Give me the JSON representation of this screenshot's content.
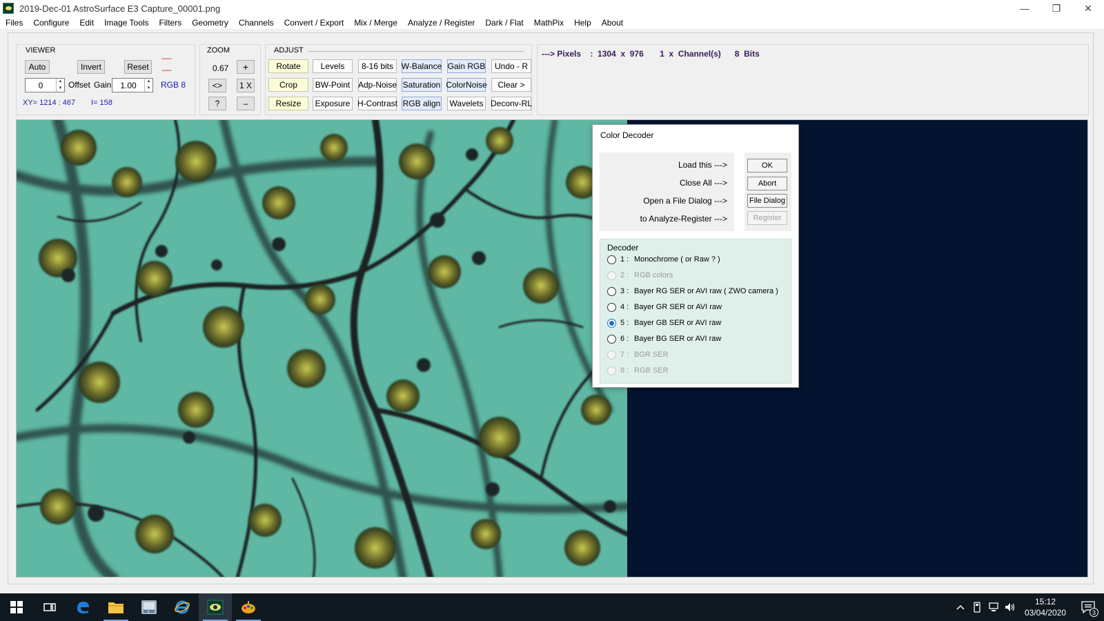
{
  "window": {
    "title": "2019-Dec-01  AstroSurface E3    Capture_00001.png",
    "controls": {
      "minimize": "—",
      "restore": "❐",
      "close": "✕"
    }
  },
  "menu": [
    "Files",
    "Configure",
    "Edit",
    "Image Tools",
    "Filters",
    "Geometry",
    "Channels",
    "Convert / Export",
    "Mix / Merge",
    "Analyze / Register",
    "Dark / Flat",
    "MathPix",
    "Help",
    "About"
  ],
  "viewer": {
    "title": "VIEWER",
    "auto": "Auto",
    "invert": "Invert",
    "reset": "Reset",
    "dash1": "------",
    "dash2": "------",
    "offset_value": "0",
    "offset_label": "Offset",
    "gain_label": "Gain",
    "gain_value": "1.00",
    "mode": "RGB 8",
    "xy": "XY=  1214 : 467",
    "intensity": "I=  158"
  },
  "zoom": {
    "title": "ZOOM",
    "value": "0.67",
    "plus": "+",
    "fit": "<>",
    "one_x": "1 X",
    "help": "?",
    "minus": "–"
  },
  "adjust": {
    "title": "ADJUST",
    "rows": [
      [
        {
          "label": "Rotate",
          "style": "yellow"
        },
        {
          "label": "Levels",
          "style": "white"
        },
        {
          "label": "8-16 bits",
          "style": "white"
        },
        {
          "label": "W-Balance",
          "style": "blue"
        },
        {
          "label": "Gain RGB",
          "style": "blue"
        },
        {
          "label": "Undo - R",
          "style": "white"
        }
      ],
      [
        {
          "label": "Crop",
          "style": "yellow"
        },
        {
          "label": "BW-Point",
          "style": "white"
        },
        {
          "label": "Adp-Noise",
          "style": "white"
        },
        {
          "label": "Saturation",
          "style": "blue"
        },
        {
          "label": "ColorNoise",
          "style": "blue"
        },
        {
          "label": "Clear >",
          "style": "white"
        }
      ],
      [
        {
          "label": "Resize",
          "style": "yellow"
        },
        {
          "label": "Exposure",
          "style": "white"
        },
        {
          "label": "H-Contrast",
          "style": "white"
        },
        {
          "label": "RGB align",
          "style": "blue"
        },
        {
          "label": "Wavelets",
          "style": "white"
        },
        {
          "label": "Deconv-RL",
          "style": "white"
        }
      ]
    ]
  },
  "info": {
    "text": "---> Pixels    :  1304  x  976       1  x  Channel(s)      8  Bits"
  },
  "dialog": {
    "title": "Color Decoder",
    "actions": [
      {
        "label": "Load this   --->"
      },
      {
        "label": "Close All   --->"
      },
      {
        "label": "Open a File Dialog   --->"
      },
      {
        "label": "to Analyze-Register   --->"
      }
    ],
    "buttons": {
      "ok": "OK",
      "abort": "Abort",
      "file_dialog": "File Dialog",
      "register": "Register"
    },
    "decoder_title": "Decoder",
    "options": [
      {
        "num": "1 :",
        "label": "Monochrome  ( or Raw ? )",
        "checked": false,
        "disabled": false
      },
      {
        "num": "2 :",
        "label": "RGB colors",
        "checked": false,
        "disabled": true
      },
      {
        "num": "3 :",
        "label": "Bayer RG  SER or AVI raw  ( ZWO camera )",
        "checked": false,
        "disabled": false
      },
      {
        "num": "4 :",
        "label": "Bayer GR  SER or AVI raw",
        "checked": false,
        "disabled": false
      },
      {
        "num": "5 :",
        "label": "Bayer GB  SER or AVI raw",
        "checked": true,
        "disabled": false
      },
      {
        "num": "6 :",
        "label": "Bayer BG  SER or AVI raw",
        "checked": false,
        "disabled": false
      },
      {
        "num": "7 :",
        "label": "BGR  SER",
        "checked": false,
        "disabled": true
      },
      {
        "num": "8 :",
        "label": "RGB  SER",
        "checked": false,
        "disabled": true
      }
    ]
  },
  "taskbar": {
    "apps": [
      "windows-start",
      "task-view",
      "edge",
      "file-explorer",
      "photos",
      "internet-explorer",
      "astrosurface",
      "paint-app"
    ],
    "time": "15:12",
    "date": "03/04/2020",
    "notification_count": "3"
  },
  "colors": {
    "sky": "#5fb8a4",
    "background": "#031330",
    "selected_radio": "#1a6ad8"
  }
}
